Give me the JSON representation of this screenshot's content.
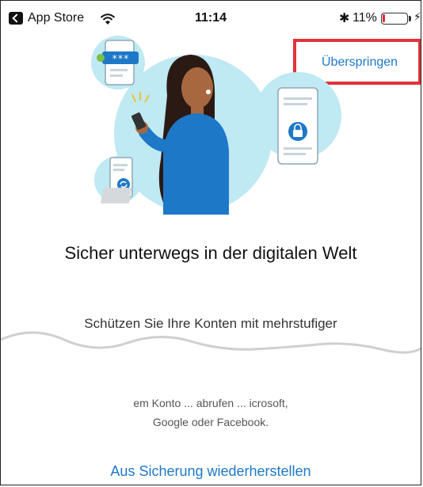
{
  "status_bar": {
    "back_app": "App Store",
    "time": "11:14",
    "bluetooth": "✱",
    "battery_percent": "11%",
    "battery_level": 0.11,
    "charging_symbol": "⚡"
  },
  "skip_label": "Überspringen",
  "title": "Sicher unterwegs in der digitalen Welt",
  "subtitle_visible": "Schützen Sie Ihre Konten mit mehrstufiger",
  "description_partial_line": "em Konto ... abrufen ... icrosoft,",
  "description_line2": "Google oder Facebook.",
  "restore_link": "Aus Sicherung wiederherstellen",
  "illustration": {
    "icons": [
      "password-phone-icon",
      "lock-phone-icon",
      "sync-phone-icon",
      "woman-with-phone"
    ],
    "accent": "#1e78c8",
    "circle": "#bfe9f3"
  }
}
